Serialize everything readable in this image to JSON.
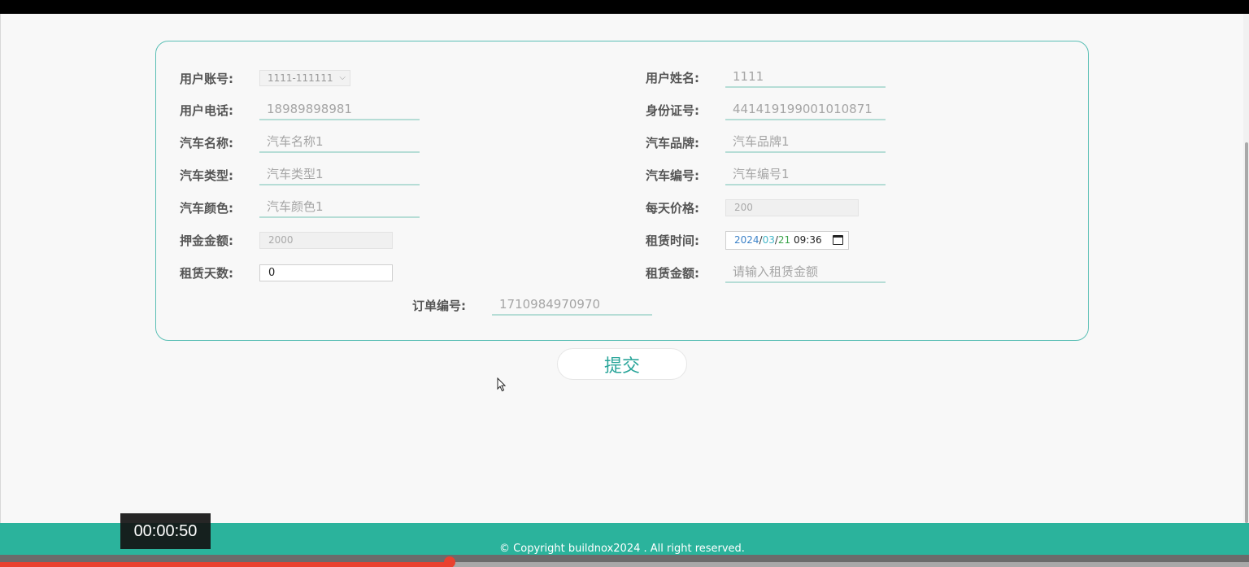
{
  "form": {
    "user_account": {
      "label": "用户账号:",
      "value": "1111-111111"
    },
    "user_name": {
      "label": "用户姓名:",
      "value": "1111"
    },
    "user_phone": {
      "label": "用户电话:",
      "value": "18989898981"
    },
    "id_number": {
      "label": "身份证号:",
      "value": "441419199001010871"
    },
    "car_name": {
      "label": "汽车名称:",
      "value": "汽车名称1"
    },
    "car_brand": {
      "label": "汽车品牌:",
      "value": "汽车品牌1"
    },
    "car_type": {
      "label": "汽车类型:",
      "value": "汽车类型1"
    },
    "car_number": {
      "label": "汽车编号:",
      "value": "汽车编号1"
    },
    "car_color": {
      "label": "汽车颜色:",
      "value": "汽车颜色1"
    },
    "daily_price": {
      "label": "每天价格:",
      "value": "200"
    },
    "deposit": {
      "label": "押金金额:",
      "value": "2000"
    },
    "rental_time": {
      "label": "租赁时间:",
      "year": "2024",
      "month": "03",
      "day": "21",
      "time": "09:36"
    },
    "rental_days": {
      "label": "租赁天数:",
      "value": "0"
    },
    "rental_amount": {
      "label": "租赁金额:",
      "placeholder": "请输入租赁金额"
    },
    "order_number": {
      "label": "订单编号:",
      "value": "1710984970970"
    }
  },
  "submit_label": "提交",
  "footer": {
    "copyright": "© Copyright buildnox2024 . All right reserved."
  },
  "video": {
    "timestamp": "00:00:50",
    "progress": 0.36
  },
  "colors": {
    "accent": "#2bb39c",
    "panel_border": "#5bbfb5",
    "progress": "#e9412f"
  }
}
